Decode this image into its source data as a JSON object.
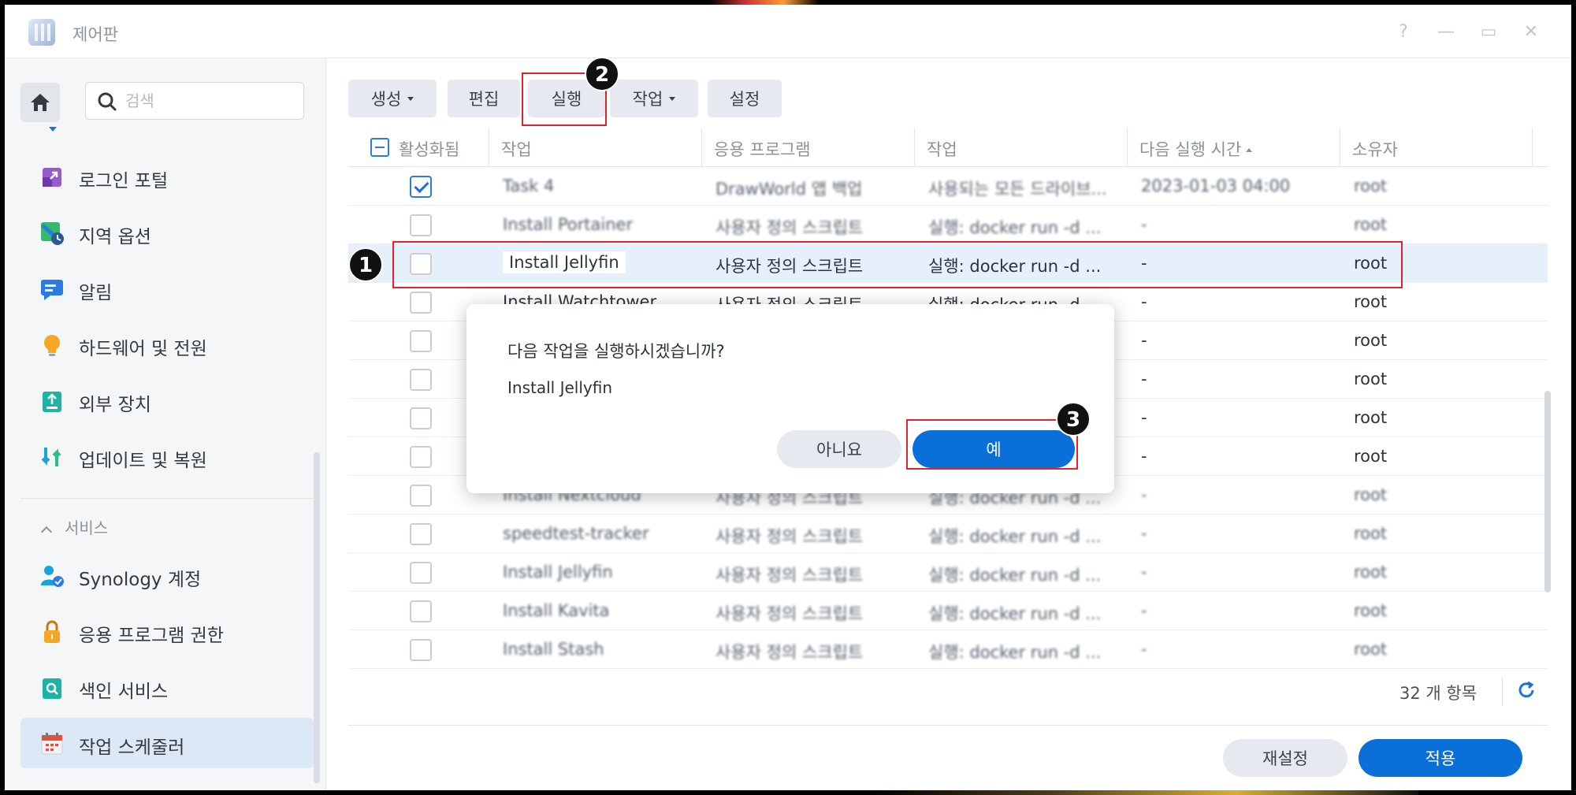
{
  "window": {
    "title": "제어판",
    "controls": [
      "?",
      "—",
      "▭",
      "✕"
    ]
  },
  "sidebar": {
    "search_placeholder": "검색",
    "section_label": "서비스",
    "items": [
      {
        "label": "로그인 포털",
        "icon": "login-portal-icon",
        "color": "#8e44c9"
      },
      {
        "label": "지역 옵션",
        "icon": "regional-options-icon",
        "color": "#2fae5c"
      },
      {
        "label": "알림",
        "icon": "notification-icon",
        "color": "#2c7be5"
      },
      {
        "label": "하드웨어 및 전원",
        "icon": "lightbulb-icon",
        "color": "#f3a21b"
      },
      {
        "label": "외부 장치",
        "icon": "external-device-icon",
        "color": "#17a89a"
      },
      {
        "label": "업데이트 및 복원",
        "icon": "update-restore-icon",
        "color": "#1aa3d8"
      },
      {
        "label": "Synology 계정",
        "icon": "synology-account-icon",
        "color": "#1aa3d8"
      },
      {
        "label": "응용 프로그램 권한",
        "icon": "lock-icon",
        "color": "#f3a21b"
      },
      {
        "label": "색인 서비스",
        "icon": "indexing-icon",
        "color": "#17a89a"
      },
      {
        "label": "작업 스케줄러",
        "icon": "calendar-icon",
        "color": "#e8503e"
      }
    ]
  },
  "toolbar": {
    "create": "생성",
    "edit": "편집",
    "run": "실행",
    "action": "작업",
    "settings": "설정"
  },
  "table": {
    "headers": [
      "활성화됨",
      "작업",
      "응용 프로그램",
      "작업",
      "다음 실행 시간",
      "소유자"
    ],
    "rows": [
      {
        "checked": true,
        "task": "Task 4",
        "app": "DrawWorld 앱 백업",
        "action": "사용되는 모든 드라이브...",
        "next": "2023-01-03 04:00",
        "owner": "root",
        "blurred": true
      },
      {
        "checked": false,
        "task": "Install Portainer",
        "app": "사용자 정의 스크립트",
        "action": "실행: docker run -d ...",
        "next": "-",
        "owner": "root",
        "blurred": true
      },
      {
        "checked": false,
        "task": "Install Jellyfin",
        "app": "사용자 정의 스크립트",
        "action": "실행: docker run -d ...",
        "next": "-",
        "owner": "root",
        "blurred": false,
        "selected": true
      },
      {
        "checked": false,
        "task": "Install Watchtower",
        "app": "사용자 정의 스크립트",
        "action": "실행: docker run -d ...",
        "next": "-",
        "owner": "root",
        "blurred": false
      },
      {
        "checked": false,
        "task": "",
        "app": "",
        "action": "",
        "next": "-",
        "owner": "root",
        "blurred": false
      },
      {
        "checked": false,
        "task": "",
        "app": "",
        "action": "",
        "next": "-",
        "owner": "root",
        "blurred": false
      },
      {
        "checked": false,
        "task": "",
        "app": "",
        "action": "",
        "next": "-",
        "owner": "root",
        "blurred": false
      },
      {
        "checked": false,
        "task": "",
        "app": "",
        "action": "",
        "next": "-",
        "owner": "root",
        "blurred": false
      },
      {
        "checked": false,
        "task": "Install Nextcloud",
        "app": "사용자 정의 스크립트",
        "action": "실행: docker run -d ...",
        "next": "-",
        "owner": "root",
        "blurred": true
      },
      {
        "checked": false,
        "task": "speedtest-tracker",
        "app": "사용자 정의 스크립트",
        "action": "실행: docker run -d ...",
        "next": "-",
        "owner": "root",
        "blurred": true
      },
      {
        "checked": false,
        "task": "Install Jellyfin",
        "app": "사용자 정의 스크립트",
        "action": "실행: docker run -d ...",
        "next": "-",
        "owner": "root",
        "blurred": true
      },
      {
        "checked": false,
        "task": "Install Kavita",
        "app": "사용자 정의 스크립트",
        "action": "실행: docker run -d ...",
        "next": "-",
        "owner": "root",
        "blurred": true
      },
      {
        "checked": false,
        "task": "Install Stash",
        "app": "사용자 정의 스크립트",
        "action": "실행: docker run -d ...",
        "next": "-",
        "owner": "root",
        "blurred": true
      }
    ],
    "count": "32 개 항목"
  },
  "footer": {
    "reset": "재설정",
    "apply": "적용"
  },
  "dialog": {
    "message": "다음 작업을 실행하시겠습니까?",
    "task_name": "Install Jellyfin",
    "no": "아니요",
    "yes": "예"
  },
  "annotations": [
    "1",
    "2",
    "3"
  ],
  "colors": {
    "accent": "#0b6fd9",
    "highlight": "#e0222a",
    "selected_row": "#e6f0fb"
  }
}
